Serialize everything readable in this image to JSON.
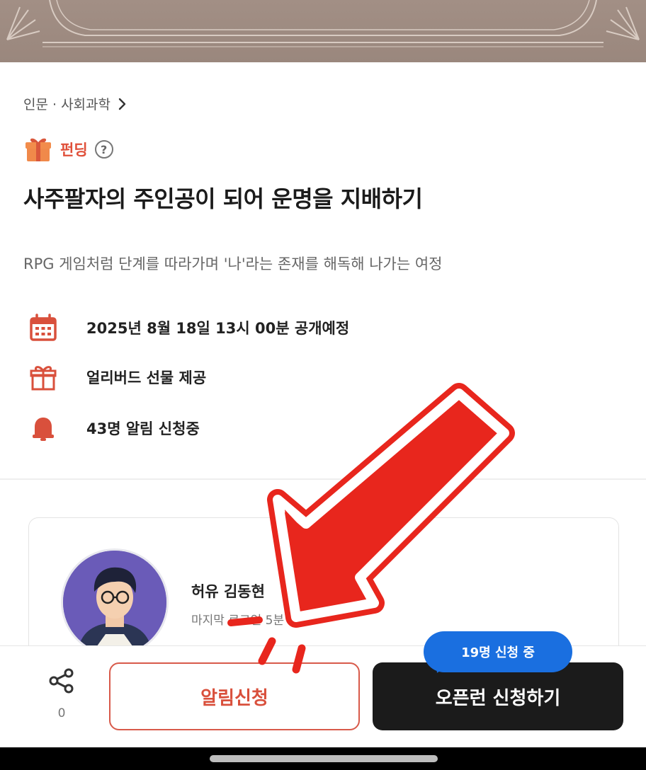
{
  "breadcrumb": {
    "category": "인문 · 사회과학"
  },
  "tag": {
    "label": "펀딩",
    "help": "?"
  },
  "title": "사주팔자의 주인공이 되어 운명을 지배하기",
  "subtitle": "RPG 게임처럼 단계를 따라가며 '나'라는 존재를 해독해 나가는 여정",
  "info": {
    "schedule": "2025년 8월 18일 13시 00분 공개예정",
    "gift": "얼리버드 선물 제공",
    "alarm": "43명 알림 신청중"
  },
  "creator": {
    "name": "허유 김동현",
    "last_login": "마지막 로그인 5분 전"
  },
  "bottom": {
    "share_count": "0",
    "notify_label": "알림신청",
    "openrun_label": "오픈런 신청하기",
    "bubble_text": "19명 신청 중"
  },
  "colors": {
    "accent": "#e0503a",
    "banner": "#9d8a80",
    "dark_button": "#1b1b1b",
    "bubble": "#1a6fe0",
    "arrow": "#e8261d"
  }
}
